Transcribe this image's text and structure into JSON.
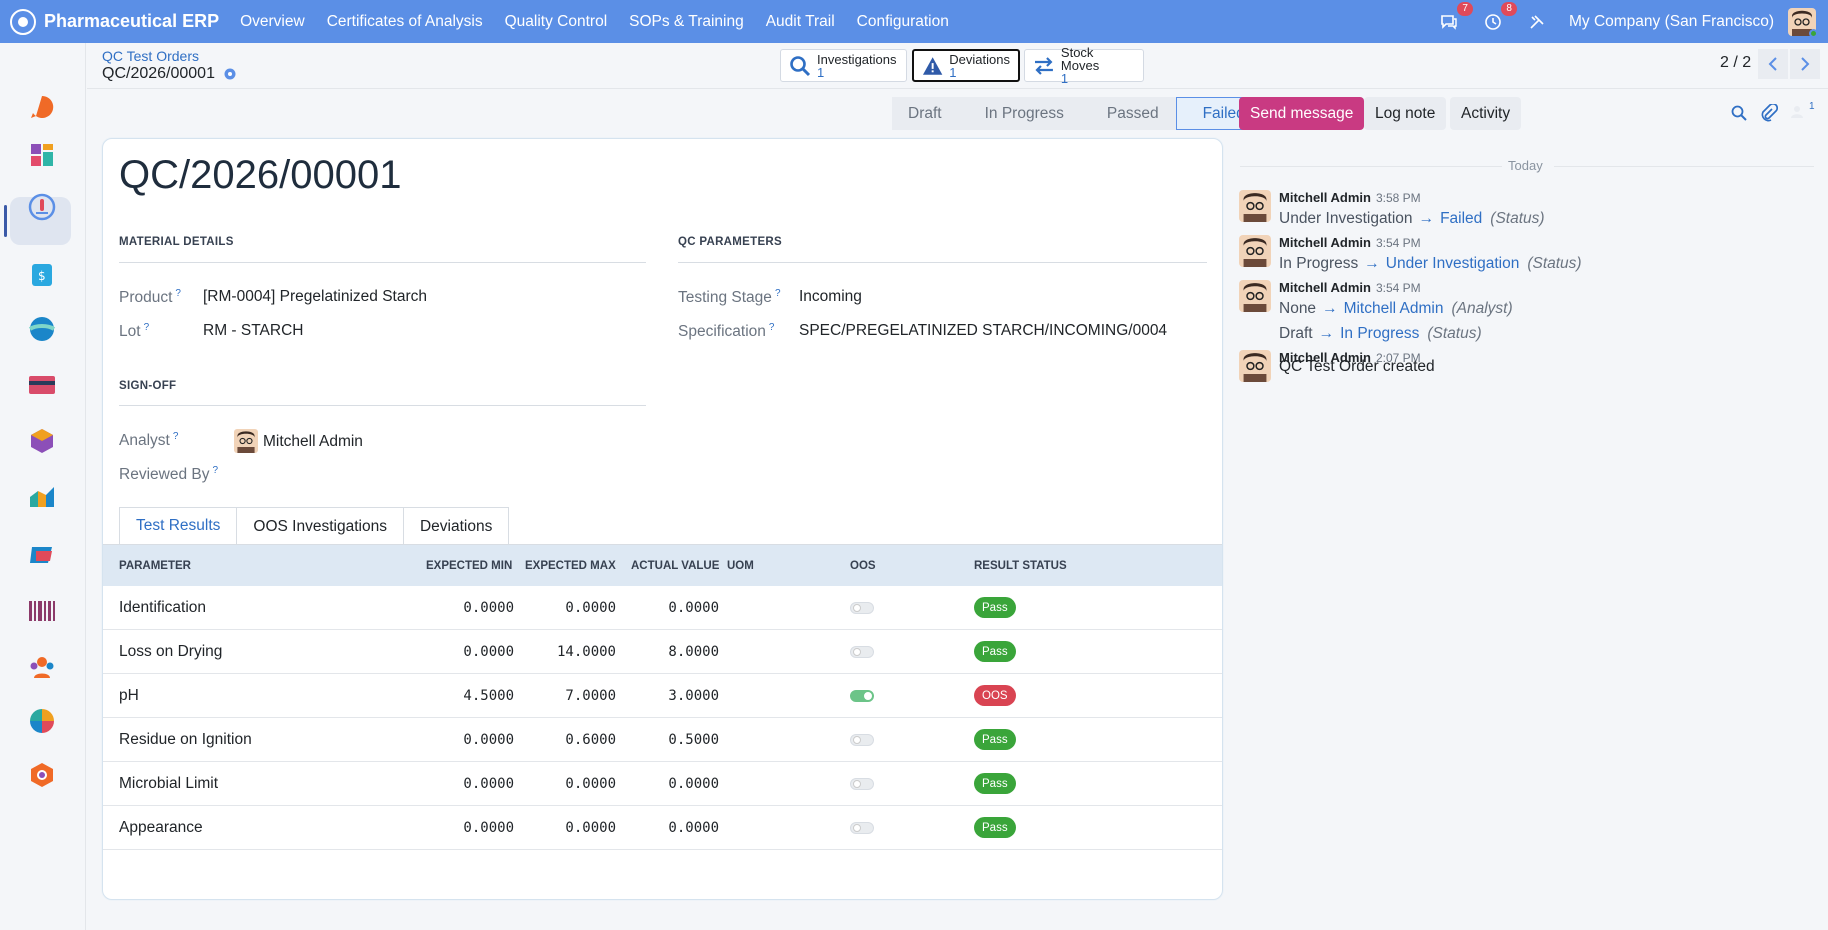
{
  "app": {
    "brand": "Pharmaceutical ERP",
    "nav": [
      "Overview",
      "Certificates of Analysis",
      "Quality Control",
      "SOPs & Training",
      "Audit Trail",
      "Configuration"
    ],
    "chat_count": "7",
    "activity_count": "8",
    "company": "My Company (San Francisco)"
  },
  "breadcrumb": {
    "parent": "QC Test Orders",
    "current": "QC/2026/00001"
  },
  "smart_buttons": {
    "investigations": {
      "label": "Investigations",
      "value": "1"
    },
    "deviations": {
      "label": "Deviations",
      "value": "1"
    },
    "stock_moves": {
      "label": "Stock Moves",
      "value": "1"
    }
  },
  "pager": "2 / 2",
  "status": {
    "stages": [
      "Draft",
      "In Progress",
      "Passed",
      "Failed"
    ],
    "current": "Failed"
  },
  "record": {
    "title": "QC/2026/00001",
    "material_section": "MATERIAL DETAILS",
    "qc_section": "QC PARAMETERS",
    "signoff_section": "SIGN-OFF",
    "product_label": "Product",
    "product": "[RM-0004] Pregelatinized Starch",
    "lot_label": "Lot",
    "lot": "RM - STARCH",
    "stage_label": "Testing Stage",
    "stage": "Incoming",
    "spec_label": "Specification",
    "spec": "SPEC/PREGELATINIZED STARCH/INCOMING/0004",
    "analyst_label": "Analyst",
    "analyst": "Mitchell Admin",
    "reviewed_label": "Reviewed By",
    "help_mark": "?"
  },
  "tabs": [
    "Test Results",
    "OOS Investigations",
    "Deviations"
  ],
  "table": {
    "headers": {
      "parameter": "PARAMETER",
      "min": "EXPECTED MIN",
      "max": "EXPECTED MAX",
      "actual": "ACTUAL VALUE",
      "uom": "UOM",
      "oos": "OOS",
      "status": "RESULT STATUS"
    },
    "rows": [
      {
        "parameter": "Identification",
        "min": "0.0000",
        "max": "0.0000",
        "actual": "0.0000",
        "uom": "",
        "oos": false,
        "status": "Pass"
      },
      {
        "parameter": "Loss on Drying",
        "min": "0.0000",
        "max": "14.0000",
        "actual": "8.0000",
        "uom": "",
        "oos": false,
        "status": "Pass"
      },
      {
        "parameter": "pH",
        "min": "4.5000",
        "max": "7.0000",
        "actual": "3.0000",
        "uom": "",
        "oos": true,
        "status": "OOS"
      },
      {
        "parameter": "Residue on Ignition",
        "min": "0.0000",
        "max": "0.6000",
        "actual": "0.5000",
        "uom": "",
        "oos": false,
        "status": "Pass"
      },
      {
        "parameter": "Microbial Limit",
        "min": "0.0000",
        "max": "0.0000",
        "actual": "0.0000",
        "uom": "",
        "oos": false,
        "status": "Pass"
      },
      {
        "parameter": "Appearance",
        "min": "0.0000",
        "max": "0.0000",
        "actual": "0.0000",
        "uom": "",
        "oos": false,
        "status": "Pass"
      }
    ]
  },
  "chatter": {
    "send_message": "Send message",
    "log_note": "Log note",
    "activity": "Activity",
    "follower_count": "1",
    "date_sep": "Today",
    "messages": [
      {
        "author": "Mitchell Admin",
        "time": "3:58 PM",
        "old": "Under Investigation",
        "new": "Failed",
        "field": "(Status)"
      },
      {
        "author": "Mitchell Admin",
        "time": "3:54 PM",
        "old": "In Progress",
        "new": "Under Investigation",
        "field": "(Status)"
      },
      {
        "author": "Mitchell Admin",
        "time": "3:54 PM",
        "old": "None",
        "new": "Mitchell Admin",
        "field": "(Analyst)",
        "old2": "Draft",
        "new2": "In Progress",
        "field2": "(Status)"
      },
      {
        "author": "Mitchell Admin",
        "time": "2:07 PM",
        "body": "QC Test Order created"
      }
    ]
  },
  "colors": {
    "navbar": "#5b8fe6",
    "accent": "#2f6fc4",
    "send": "#c93a82",
    "pass": "#3aa53a",
    "oos": "#d94452"
  }
}
